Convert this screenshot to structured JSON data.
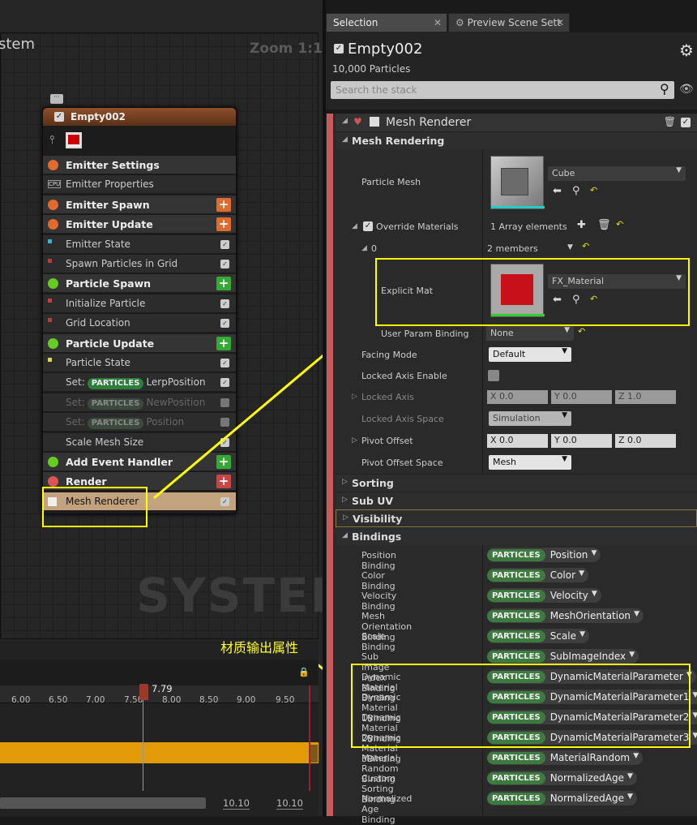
{
  "graph": {
    "title": "stem",
    "zoom": "Zoom 1:1",
    "watermark": "SYSTEM"
  },
  "node": {
    "title": "Empty002",
    "rows": [
      {
        "label": "Emitter Settings",
        "kind": "head",
        "icon": "#e06b2d",
        "icon_name": "emitter-settings-icon"
      },
      {
        "label": "Emitter Properties",
        "kind": "item",
        "cpu": "CPU"
      },
      {
        "label": "Emitter Spawn",
        "kind": "head",
        "icon": "#e06b2d",
        "icon_name": "emitter-spawn-icon",
        "plus": "#e06b2d"
      },
      {
        "label": "Emitter Update",
        "kind": "head",
        "icon": "#e06b2d",
        "icon_name": "emitter-update-icon",
        "plus": "#e06b2d"
      },
      {
        "label": "Emitter State",
        "kind": "item",
        "dot": "#2bd",
        "check": true
      },
      {
        "label": "Spawn Particles in Grid",
        "kind": "item",
        "dot": "#c33",
        "check": true
      },
      {
        "label": "Particle Spawn",
        "kind": "head",
        "icon": "#6c2",
        "icon_name": "particle-spawn-icon",
        "plus": "#3a3"
      },
      {
        "label": "Initialize Particle",
        "kind": "item",
        "dot": "#d33",
        "check": true
      },
      {
        "label": "Grid Location",
        "kind": "item",
        "dot": "#c33",
        "check": true
      },
      {
        "label": "Particle Update",
        "kind": "head",
        "icon": "#6c2",
        "icon_name": "particle-update-icon",
        "plus": "#3a3"
      },
      {
        "label": "Particle State",
        "kind": "item",
        "dot": "#dd3",
        "check": true
      },
      {
        "label": "LerpPosition",
        "kind": "set",
        "pill": "PARTICLES",
        "set": "Set:",
        "check": true
      },
      {
        "label": "NewPosition",
        "kind": "set",
        "pill": "PARTICLES",
        "set": "Set:",
        "dim": true,
        "check": false
      },
      {
        "label": "Position",
        "kind": "set",
        "pill": "PARTICLES",
        "set": "Set:",
        "dim": true,
        "check": false
      },
      {
        "label": "Scale Mesh Size",
        "kind": "item",
        "check": true
      },
      {
        "label": "Add Event Handler",
        "kind": "head",
        "icon": "#6c2",
        "icon_name": "event-handler-icon",
        "plus": "#3a3"
      },
      {
        "label": "Render",
        "kind": "head",
        "icon": "#d55",
        "icon_name": "render-icon",
        "plus": "#c44"
      },
      {
        "label": "Mesh Renderer",
        "kind": "item",
        "sel": true,
        "check": true
      }
    ]
  },
  "timeline": {
    "playhead": "7.79",
    "ticks": [
      "6.00",
      "6.50",
      "7.00",
      "7.50",
      "8.00",
      "8.50",
      "9.00",
      "9.50"
    ],
    "start": "10.10",
    "end": "10.10"
  },
  "annotation": "材质输出属性",
  "tabs": {
    "selection": "Selection",
    "preview": "Preview Scene Sett"
  },
  "header": {
    "title": "Empty002",
    "particles": "10,000 Particles",
    "search_placeholder": "Search the stack"
  },
  "renderer": {
    "title": "Mesh Renderer",
    "sections": {
      "mesh_rendering": "Mesh Rendering",
      "sorting": "Sorting",
      "sub_uv": "Sub UV",
      "visibility": "Visibility",
      "bindings": "Bindings"
    },
    "particle_mesh": {
      "label": "Particle Mesh",
      "value": "Cube"
    },
    "override": {
      "label": "Override Materials",
      "value": "1 Array elements",
      "index": "0",
      "members": "2 members"
    },
    "explicit": {
      "label": "Explicit Mat",
      "value": "FX_Material"
    },
    "user_param": {
      "label": "User Param Binding",
      "value": "None"
    },
    "facing": {
      "label": "Facing Mode",
      "value": "Default"
    },
    "locked_enable": {
      "label": "Locked Axis Enable"
    },
    "locked_axis": {
      "label": "Locked Axis",
      "x": "X  0.0",
      "y": "Y  0.0",
      "z": "Z  1.0"
    },
    "locked_space": {
      "label": "Locked Axis Space",
      "value": "Simulation"
    },
    "pivot": {
      "label": "Pivot Offset",
      "x": "X  0.0",
      "y": "Y  0.0",
      "z": "Z  0.0"
    },
    "pivot_space": {
      "label": "Pivot Offset Space",
      "value": "Mesh"
    },
    "bindings": [
      {
        "label": "Position Binding",
        "value": "Position"
      },
      {
        "label": "Color Binding",
        "value": "Color"
      },
      {
        "label": "Velocity Binding",
        "value": "Velocity"
      },
      {
        "label": "Mesh Orientation Binding",
        "value": "MeshOrientation"
      },
      {
        "label": "Scale Binding",
        "value": "Scale"
      },
      {
        "label": "Sub Image Index Binding",
        "value": "SubImageIndex"
      },
      {
        "label": "Dynamic Material Binding",
        "value": "DynamicMaterialParameter"
      },
      {
        "label": "Dynamic Material 1Binding",
        "value": "DynamicMaterialParameter1"
      },
      {
        "label": "Dynamic Material 2Binding",
        "value": "DynamicMaterialParameter2"
      },
      {
        "label": "Dynamic Material 3Binding",
        "value": "DynamicMaterialParameter3"
      },
      {
        "label": "Material Random Binding",
        "value": "MaterialRandom"
      },
      {
        "label": "Custom Sorting Binding",
        "value": "NormalizedAge"
      },
      {
        "label": "Normalized Age Binding",
        "value": "NormalizedAge"
      }
    ],
    "bind_tag": "PARTICLES"
  }
}
